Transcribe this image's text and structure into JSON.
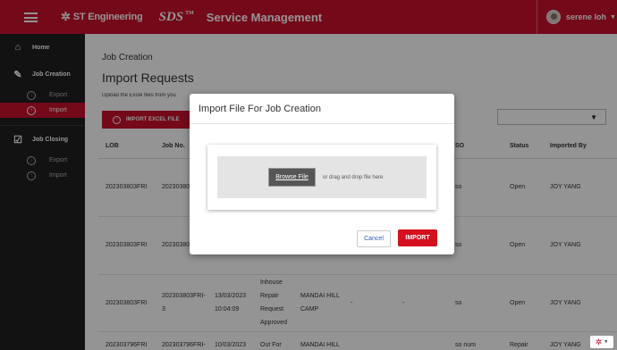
{
  "header": {
    "company_logo": "ST Engineering",
    "product_logo": "SDS",
    "product_logo_mark": "TM",
    "app_title": "Service Management",
    "user_name": "serene loh"
  },
  "sidebar": {
    "home": "Home",
    "job_creation": "Job Creation",
    "job_creation_items": [
      "Export",
      "Import"
    ],
    "job_closing": "Job Closing",
    "job_closing_items": [
      "Export",
      "Import"
    ]
  },
  "main": {
    "breadcrumb": "Job Creation",
    "title": "Import Requests",
    "description": "Upload the Excel files from you",
    "import_button": "IMPORT EXCEL FILE",
    "filter_value": ""
  },
  "table": {
    "columns": [
      "LOB",
      "Job No.",
      "",
      "",
      "",
      "",
      "",
      "SO",
      "Status",
      "Imported By"
    ],
    "rows": [
      [
        "202303803FRI",
        "20230380 1",
        "",
        "",
        "",
        "",
        "",
        "so",
        "Open",
        "JOY YANG"
      ],
      [
        "202303803FRI",
        "20230380 2",
        "",
        "",
        "",
        "",
        "",
        "so",
        "Open",
        "JOY YANG"
      ],
      [
        "202303803FRI",
        "202303803FRI-3",
        "13/03/2023 10:04:09",
        "Inhouse Repair Request Approved",
        "MANDAI HILL CAMP",
        "-",
        "-",
        "so",
        "Open",
        "JOY YANG"
      ],
      [
        "202303796FRI",
        "202303796FRI-",
        "10/03/2023",
        "Out For",
        "MANDAI HILL",
        "",
        "",
        "so num",
        "Repair",
        "JOY YANG"
      ]
    ]
  },
  "modal": {
    "title": "Import File For Job Creation",
    "browse_label": "Browse File",
    "drop_text": "or drag and drop file here",
    "cancel_label": "Cancel",
    "import_label": "IMPORT"
  }
}
